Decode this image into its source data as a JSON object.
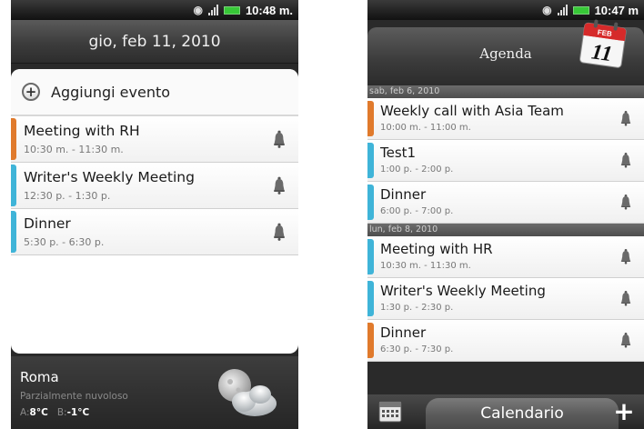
{
  "left_screen": {
    "status_time": "10:48 m.",
    "date_header": "gio, feb 11, 2010",
    "add_event_label": "Aggiungi evento",
    "events": [
      {
        "title": "Meeting with RH",
        "time": "10:30 m. - 11:30 m.",
        "color": "#e07a2c"
      },
      {
        "title": "Writer's Weekly Meeting",
        "time": "12:30 p. - 1:30 p.",
        "color": "#3fb4d8"
      },
      {
        "title": "Dinner",
        "time": "5:30 p. - 6:30 p.",
        "color": "#3fb4d8"
      }
    ],
    "weather": {
      "city": "Roma",
      "condition": "Parzialmente nuvoloso",
      "high_label": "A:",
      "high": "8°C",
      "low_label": "B:",
      "low": "-1°C",
      "icon": "partly-cloudy-night-icon"
    }
  },
  "right_screen": {
    "status_time": "10:47 m",
    "header_title": "Agenda",
    "calendar_month": "FEB",
    "calendar_day": "11",
    "groups": [
      {
        "date": "sab, feb 6, 2010",
        "events": [
          {
            "title": "Weekly call with Asia Team",
            "time": "10:00 m. - 11:00 m.",
            "color": "#e07a2c"
          },
          {
            "title": "Test1",
            "time": "1:00 p. - 2:00 p.",
            "color": "#3fb4d8"
          },
          {
            "title": "Dinner",
            "time": "6:00 p. - 7:00 p.",
            "color": "#3fb4d8"
          }
        ]
      },
      {
        "date": "lun, feb 8, 2010",
        "events": [
          {
            "title": "Meeting with HR",
            "time": "10:30 m. - 11:30 m.",
            "color": "#3fb4d8"
          },
          {
            "title": "Writer's Weekly Meeting",
            "time": "1:30 p. - 2:30 p.",
            "color": "#3fb4d8"
          },
          {
            "title": "Dinner",
            "time": "6:30 p. - 7:30 p.",
            "color": "#e07a2c"
          }
        ]
      }
    ],
    "bottom_tab_label": "Calendario",
    "add_button_label": "+"
  }
}
